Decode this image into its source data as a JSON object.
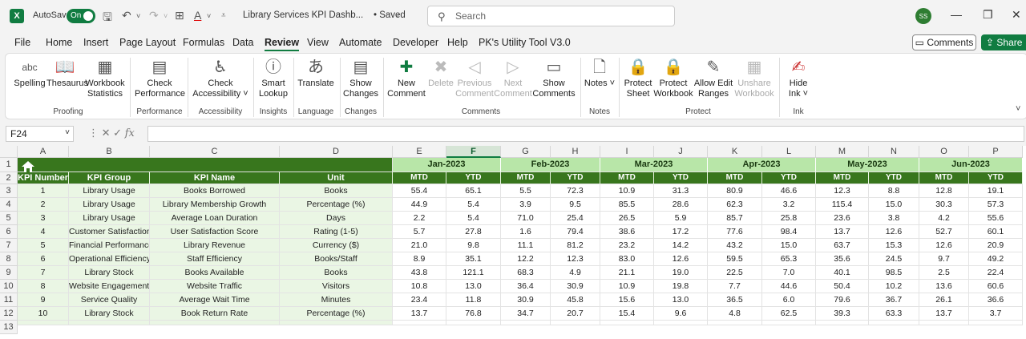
{
  "titlebar": {
    "app_logo": "X",
    "autosave_label": "AutoSave",
    "toggle_label": "On",
    "doc_title": "Library Services KPI Dashb...",
    "saved_label": "• Saved",
    "search_placeholder": "Search",
    "user_initials": "SS"
  },
  "menu": [
    "File",
    "Home",
    "Insert",
    "Page Layout",
    "Formulas",
    "Data",
    "Review",
    "View",
    "Automate",
    "Developer",
    "Help",
    "PK's Utility Tool V3.0"
  ],
  "menu_active": "Review",
  "comments_button": "Comments",
  "share_button": "Share",
  "ribbon": {
    "buttons": [
      {
        "id": "spelling",
        "label": "Spelling",
        "icon": "abc"
      },
      {
        "id": "thesaurus",
        "label": "Thesaurus",
        "icon": "📖"
      },
      {
        "id": "workbook-statistics",
        "label": "Workbook Statistics",
        "icon": "▦"
      },
      {
        "id": "check-performance",
        "label": "Check Performance",
        "icon": "▤"
      },
      {
        "id": "check-accessibility",
        "label": "Check Accessibility ˅",
        "icon": "♿"
      },
      {
        "id": "smart-lookup",
        "label": "Smart Lookup",
        "icon": "ⓘ"
      },
      {
        "id": "translate",
        "label": "Translate",
        "icon": "あ"
      },
      {
        "id": "show-changes",
        "label": "Show Changes",
        "icon": "▤"
      },
      {
        "id": "new-comment",
        "label": "New Comment",
        "icon": "✚"
      },
      {
        "id": "delete",
        "label": "Delete",
        "icon": "✖"
      },
      {
        "id": "previous-comment",
        "label": "Previous Comment",
        "icon": "◁"
      },
      {
        "id": "next-comment",
        "label": "Next Comment",
        "icon": "▷"
      },
      {
        "id": "show-comments",
        "label": "Show Comments",
        "icon": "▭"
      },
      {
        "id": "notes",
        "label": "Notes ˅",
        "icon": "🗋"
      },
      {
        "id": "protect-sheet",
        "label": "Protect Sheet",
        "icon": "🔒"
      },
      {
        "id": "protect-workbook",
        "label": "Protect Workbook",
        "icon": "🔒"
      },
      {
        "id": "allow-edit-ranges",
        "label": "Allow Edit Ranges",
        "icon": "✎"
      },
      {
        "id": "unshare-workbook",
        "label": "Unshare Workbook",
        "icon": "▦"
      },
      {
        "id": "hide-ink",
        "label": "Hide Ink ˅",
        "icon": "✍"
      }
    ],
    "groups": [
      "Proofing",
      "Performance",
      "Accessibility",
      "Insights",
      "Language",
      "Changes",
      "Comments",
      "Notes",
      "Protect",
      "Ink"
    ]
  },
  "formula_bar": {
    "name_box": "F24",
    "fx": "fx",
    "value": ""
  },
  "columns": [
    "A",
    "B",
    "C",
    "D",
    "E",
    "F",
    "G",
    "H",
    "I",
    "J",
    "K",
    "L",
    "M",
    "N",
    "O",
    "P"
  ],
  "selected_column": "F",
  "rows": [
    "1",
    "2",
    "3",
    "4",
    "5",
    "6",
    "7",
    "8",
    "9",
    "10",
    "11",
    "12",
    "13"
  ],
  "sheet": {
    "months": [
      "Jan-2023",
      "Feb-2023",
      "Mar-2023",
      "Apr-2023",
      "May-2023",
      "Jun-2023"
    ],
    "headers": [
      "KPI Number",
      "KPI Group",
      "KPI Name",
      "Unit"
    ],
    "mtd": "MTD",
    "ytd": "YTD",
    "data": [
      [
        "1",
        "Library Usage",
        "Books Borrowed",
        "Books",
        "55.4",
        "65.1",
        "5.5",
        "72.3",
        "10.9",
        "31.3",
        "80.9",
        "46.6",
        "12.3",
        "8.8",
        "12.8",
        "19.1"
      ],
      [
        "2",
        "Library Usage",
        "Library Membership Growth",
        "Percentage (%)",
        "44.9",
        "5.4",
        "3.9",
        "9.5",
        "85.5",
        "28.6",
        "62.3",
        "3.2",
        "115.4",
        "15.0",
        "30.3",
        "57.3"
      ],
      [
        "3",
        "Library Usage",
        "Average Loan Duration",
        "Days",
        "2.2",
        "5.4",
        "71.0",
        "25.4",
        "26.5",
        "5.9",
        "85.7",
        "25.8",
        "23.6",
        "3.8",
        "4.2",
        "55.6"
      ],
      [
        "4",
        "Customer Satisfaction",
        "User Satisfaction Score",
        "Rating (1-5)",
        "5.7",
        "27.8",
        "1.6",
        "79.4",
        "38.6",
        "17.2",
        "77.6",
        "98.4",
        "13.7",
        "12.6",
        "52.7",
        "60.1"
      ],
      [
        "5",
        "Financial Performance",
        "Library Revenue",
        "Currency ($)",
        "21.0",
        "9.8",
        "11.1",
        "81.2",
        "23.2",
        "14.2",
        "43.2",
        "15.0",
        "63.7",
        "15.3",
        "12.6",
        "20.9"
      ],
      [
        "6",
        "Operational Efficiency",
        "Staff Efficiency",
        "Books/Staff",
        "8.9",
        "35.1",
        "12.2",
        "12.3",
        "83.0",
        "12.6",
        "59.5",
        "65.3",
        "35.6",
        "24.5",
        "9.7",
        "49.2"
      ],
      [
        "7",
        "Library Stock",
        "Books Available",
        "Books",
        "43.8",
        "121.1",
        "68.3",
        "4.9",
        "21.1",
        "19.0",
        "22.5",
        "7.0",
        "40.1",
        "98.5",
        "2.5",
        "22.4"
      ],
      [
        "8",
        "Website Engagement",
        "Website Traffic",
        "Visitors",
        "10.8",
        "13.0",
        "36.4",
        "30.9",
        "10.9",
        "19.8",
        "7.7",
        "44.6",
        "50.4",
        "10.2",
        "13.6",
        "60.6"
      ],
      [
        "9",
        "Service Quality",
        "Average Wait Time",
        "Minutes",
        "23.4",
        "11.8",
        "30.9",
        "45.8",
        "15.6",
        "13.0",
        "36.5",
        "6.0",
        "79.6",
        "36.7",
        "26.1",
        "36.6"
      ],
      [
        "10",
        "Library Stock",
        "Book Return Rate",
        "Percentage (%)",
        "13.7",
        "76.8",
        "34.7",
        "20.7",
        "15.4",
        "9.6",
        "4.8",
        "62.5",
        "39.3",
        "63.3",
        "13.7",
        "3.7"
      ]
    ]
  }
}
